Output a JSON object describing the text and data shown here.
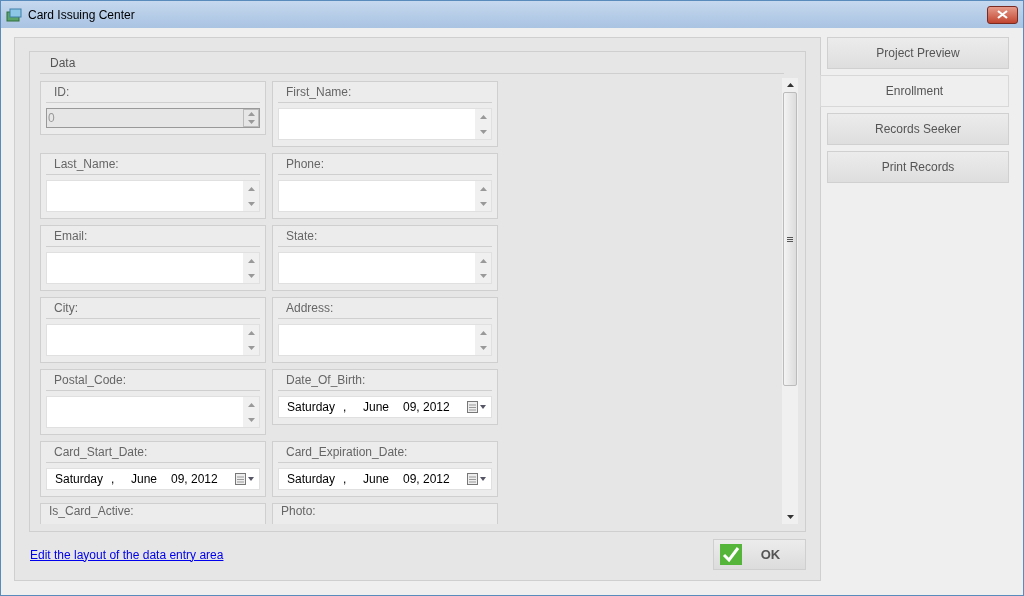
{
  "window": {
    "title": "Card Issuing Center"
  },
  "data_group": {
    "title": "Data"
  },
  "fields": [
    {
      "label": "ID:",
      "kind": "number",
      "value": "0",
      "disabled": true
    },
    {
      "label": "First_Name:",
      "kind": "text",
      "disabled": false
    },
    {
      "label": "Last_Name:",
      "kind": "text",
      "disabled": false
    },
    {
      "label": "Phone:",
      "kind": "text",
      "disabled": false
    },
    {
      "label": "Email:",
      "kind": "text",
      "disabled": false
    },
    {
      "label": "State:",
      "kind": "text",
      "disabled": false
    },
    {
      "label": "City:",
      "kind": "text",
      "disabled": false
    },
    {
      "label": "Address:",
      "kind": "text",
      "disabled": false
    },
    {
      "label": "Postal_Code:",
      "kind": "text",
      "disabled": false
    },
    {
      "label": "Date_Of_Birth:",
      "kind": "date",
      "date_parts": [
        "Saturday",
        ",",
        "June",
        "09, 2012"
      ],
      "disabled": false
    },
    {
      "label": "Card_Start_Date:",
      "kind": "date",
      "date_parts": [
        "Saturday",
        ",",
        "June",
        "09, 2012"
      ],
      "disabled": false
    },
    {
      "label": "Card_Expiration_Date:",
      "kind": "date",
      "date_parts": [
        "Saturday",
        ",",
        "June",
        "09, 2012"
      ],
      "disabled": false
    },
    {
      "label": "Is_Card_Active:",
      "kind": "cut"
    },
    {
      "label": "Photo:",
      "kind": "cut"
    }
  ],
  "link": "Edit the layout of the data entry area",
  "ok_button": "OK",
  "nav_tabs": [
    {
      "label": "Project Preview",
      "selected": false
    },
    {
      "label": "Enrollment",
      "selected": true
    },
    {
      "label": "Records Seeker",
      "selected": false
    },
    {
      "label": "Print Records",
      "selected": false
    }
  ]
}
